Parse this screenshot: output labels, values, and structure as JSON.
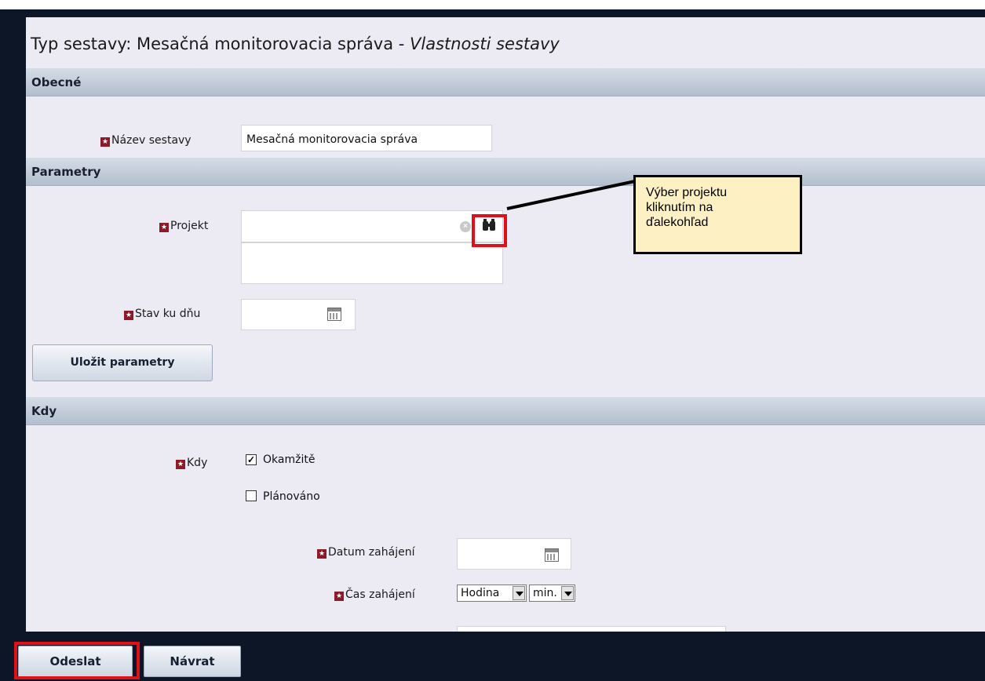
{
  "header": {
    "title_prefix": "Typ sestavy: Mesačná monitorovacia správa - ",
    "title_suffix": "Vlastnosti sestavy"
  },
  "sections": {
    "general": "Obecné",
    "parameters": "Parametry",
    "when": "Kdy"
  },
  "form": {
    "report_name_label": "Název sestavy",
    "report_name_value": "Mesačná monitorovacia správa",
    "project_label": "Projekt",
    "project_value": "",
    "status_date_label": "Stav ku dňu",
    "status_date_value": "",
    "save_params_label": "Uložit parametry",
    "when_label": "Kdy",
    "immediately_label": "Okamžitě",
    "immediately_checked": true,
    "scheduled_label": "Plánováno",
    "scheduled_checked": false,
    "start_date_label": "Datum zahájení",
    "start_date_value": "",
    "start_time_label": "Čas zahájení",
    "hour_select_value": "Hodina",
    "minute_select_value": "min."
  },
  "callout": {
    "text": "Výber projektu\nkliknutím na\nďalekohľad"
  },
  "footer": {
    "submit_label": "Odeslat",
    "back_label": "Návrat"
  },
  "icons": {
    "required_marker": "required-star-icon",
    "calendar": "calendar-icon",
    "binoculars": "binoculars-icon",
    "clear": "clear-icon"
  },
  "colors": {
    "highlight": "#e0101a",
    "callout_bg": "#fdf0c2",
    "frame": "#0c1626",
    "section_bar": "#c3ccd8"
  }
}
